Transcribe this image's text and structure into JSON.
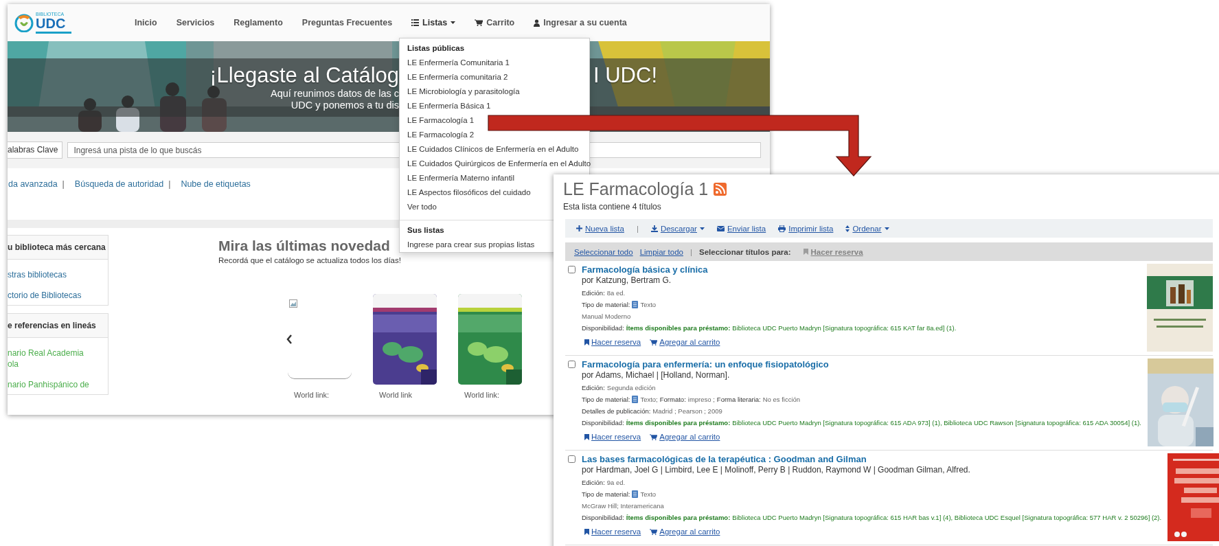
{
  "left_page": {
    "logo": {
      "top": "BIBLIOTECA",
      "main": "UDC"
    },
    "nav": [
      {
        "label": "Inicio",
        "kind": "link",
        "expanded": false
      },
      {
        "label": "Servicios",
        "kind": "link",
        "expanded": false
      },
      {
        "label": "Reglamento",
        "kind": "link",
        "expanded": false
      },
      {
        "label": "Preguntas Frecuentes",
        "kind": "link",
        "expanded": false
      },
      {
        "label": "Listas",
        "kind": "list-menu",
        "expanded": true
      },
      {
        "label": "Carrito",
        "kind": "cart",
        "expanded": false
      },
      {
        "label": "Ingresar a su cuenta",
        "kind": "account",
        "expanded": false
      }
    ],
    "banner": {
      "title_parts": [
        "¡Llegaste al Catálog",
        "I UDC!"
      ],
      "subtitle_lines": [
        "Aquí reunimos datos de las c",
        "UDC y ponemos a tu dis"
      ]
    },
    "search": {
      "scope": "alabras Clave",
      "placeholder": "Ingresá una pista de lo que buscás"
    },
    "links": [
      {
        "kind": "link",
        "label": "da avanzada"
      },
      {
        "kind": "separator",
        "label": "|"
      },
      {
        "kind": "link",
        "label": "Búsqueda de autoridad"
      },
      {
        "kind": "separator",
        "label": "|"
      },
      {
        "kind": "link",
        "label": "Nube de etiquetas"
      }
    ],
    "sidebar": [
      {
        "heading": "u biblioteca más cercana",
        "kind": "library",
        "items": [
          [
            "stras bibliotecas"
          ],
          [
            "ctorio de Bibliotecas"
          ]
        ]
      },
      {
        "heading": "e referencias en lineás",
        "kind": "reference",
        "items": [
          [
            "nario Real Academia",
            "ola"
          ],
          [
            "nario Panhispánico de"
          ]
        ]
      }
    ],
    "news": {
      "heading": "Mira las últimas novedad",
      "subtitle": "Recordá que el catálogo se actualiza todos los días!",
      "items": [
        {
          "kind": "broken-image",
          "caption": "World link:"
        },
        {
          "kind": "picture",
          "caption": "World link"
        },
        {
          "kind": "picture",
          "caption": "World link:"
        }
      ]
    }
  },
  "lists_menu": {
    "sections": [
      {
        "heading": "Listas públicas",
        "items": [
          "LE Enfermería Comunitaria 1",
          "LE Enfermería comunitaria 2",
          "LE Microbiología y parasitología",
          "LE Enfermería Básica 1",
          "LE Farmacología 1",
          "LE Farmacología 2",
          "LE Cuidados Clínicos de Enfermería en el Adulto",
          "LE Cuidados Quirúrgicos de Enfermería en el Adulto",
          "LE Enfermería Materno infantil",
          "LE Aspectos filosóficos del cuidado",
          "Ver todo"
        ]
      },
      {
        "heading": "Sus listas",
        "items": [
          "Ingrese para crear sus propias listas"
        ]
      }
    ]
  },
  "right_page": {
    "title": "LE Farmacología 1",
    "summary": "Esta lista contiene 4 títulos",
    "toolbar": [
      {
        "kind": "new",
        "label": "Nueva lista",
        "menu": false
      },
      {
        "kind": "separator",
        "label": "|"
      },
      {
        "kind": "download",
        "label": "Descargar",
        "menu": true
      },
      {
        "kind": "email",
        "label": "Enviar lista",
        "menu": false
      },
      {
        "kind": "print",
        "label": "Imprimir lista",
        "menu": false
      },
      {
        "kind": "sort",
        "label": "Ordenar",
        "menu": true
      }
    ],
    "selection_bar": [
      {
        "kind": "link",
        "label": "Seleccionar todo"
      },
      {
        "kind": "link",
        "label": "Limpiar todo"
      },
      {
        "kind": "separator",
        "label": "|"
      },
      {
        "kind": "label",
        "label": "Seleccionar títulos para:"
      },
      {
        "kind": "hold",
        "label": "Hacer reserva",
        "disabled": true
      }
    ],
    "records": [
      {
        "checked": false,
        "title": "Farmacología básica y clínica",
        "author": "por Katzung, Bertram G.",
        "lines": [
          [
            {
              "kind": "label",
              "text": "Edición:"
            },
            {
              "kind": "value",
              "text": "8a ed."
            }
          ],
          [
            {
              "kind": "label",
              "text": "Tipo de material:"
            },
            {
              "kind": "material-icon"
            },
            {
              "kind": "value",
              "text": "Texto"
            }
          ],
          [
            {
              "kind": "value",
              "text": "Manual Moderno"
            }
          ],
          [
            {
              "kind": "label",
              "text": "Disponibilidad:"
            },
            {
              "kind": "status",
              "text": "Ítems disponibles para préstamo:"
            },
            {
              "kind": "location",
              "text": "Biblioteca UDC Puerto Madryn [Signatura topográfica: 615 KAT far 8a.ed] (1)."
            }
          ]
        ],
        "actions": [
          {
            "kind": "hold",
            "label": "Hacer reserva"
          },
          {
            "kind": "cart",
            "label": "Agregar al carrito"
          }
        ]
      },
      {
        "checked": false,
        "title": "Farmacología para enfermería: un enfoque fisiopatológico",
        "author": "por Adams, Michael | [Holland, Norman].",
        "lines": [
          [
            {
              "kind": "label",
              "text": "Edición:"
            },
            {
              "kind": "value",
              "text": "Segunda edición"
            }
          ],
          [
            {
              "kind": "label",
              "text": "Tipo de material:"
            },
            {
              "kind": "material-icon"
            },
            {
              "kind": "value",
              "text": "Texto;"
            },
            {
              "kind": "label",
              "text": "Formato:"
            },
            {
              "kind": "value",
              "text": "impreso ;"
            },
            {
              "kind": "label",
              "text": "Forma literaria:"
            },
            {
              "kind": "value",
              "text": "No es ficción"
            }
          ],
          [
            {
              "kind": "label",
              "text": "Detalles de publicación:"
            },
            {
              "kind": "value",
              "text": "Madrid ; Pearson ; 2009"
            }
          ],
          [
            {
              "kind": "label",
              "text": "Disponibilidad:"
            },
            {
              "kind": "status",
              "text": "Ítems disponibles para préstamo:"
            },
            {
              "kind": "location",
              "text": "Biblioteca UDC Puerto Madryn [Signatura topográfica: 615 ADA 973] (1), Biblioteca UDC Rawson [Signatura topográfica: 615 ADA 30054] (1)."
            }
          ]
        ],
        "actions": [
          {
            "kind": "hold",
            "label": "Hacer reserva"
          },
          {
            "kind": "cart",
            "label": "Agregar al carrito"
          }
        ]
      },
      {
        "checked": false,
        "title": "Las bases farmacológicas de la terapéutica : Goodman and Gilman",
        "author": "por Hardman, Joel G | Limbird, Lee E | Molinoff, Perry B | Ruddon, Raymond W | Goodman Gilman, Alfred.",
        "lines": [
          [
            {
              "kind": "label",
              "text": "Edición:"
            },
            {
              "kind": "value",
              "text": "9a ed."
            }
          ],
          [
            {
              "kind": "label",
              "text": "Tipo de material:"
            },
            {
              "kind": "material-icon"
            },
            {
              "kind": "value",
              "text": "Texto"
            }
          ],
          [
            {
              "kind": "value",
              "text": "McGraw Hill; Interamericana"
            }
          ],
          [
            {
              "kind": "label",
              "text": "Disponibilidad:"
            },
            {
              "kind": "status",
              "text": "Ítems disponibles para préstamo:"
            },
            {
              "kind": "location",
              "text": "Biblioteca UDC Puerto Madryn [Signatura topográfica: 615 HAR bas v.1] (4), Biblioteca UDC Esquel [Signatura topográfica: 577 HAR v. 2 50296] (2)."
            }
          ]
        ],
        "actions": [
          {
            "kind": "hold",
            "label": "Hacer reserva"
          },
          {
            "kind": "cart",
            "label": "Agregar al carrito"
          }
        ]
      }
    ]
  }
}
